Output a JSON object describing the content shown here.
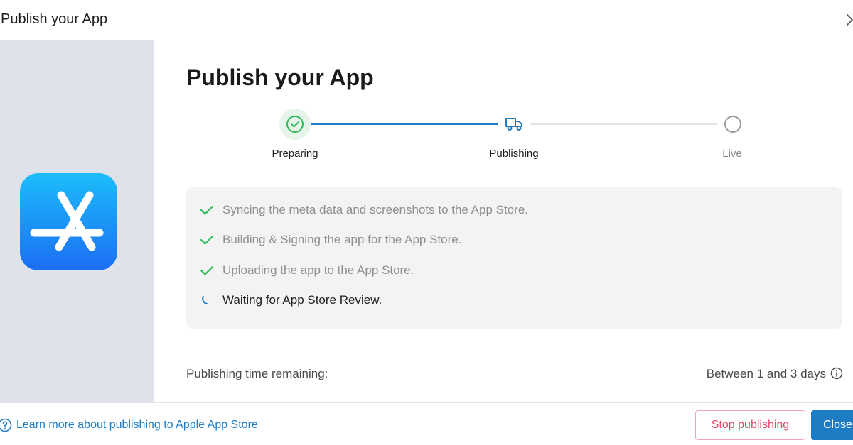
{
  "header": {
    "title": "Publish your App",
    "close_icon": "chevron-right-icon"
  },
  "sidebar": {
    "app_icon": "app-store-icon",
    "icon_gradient": [
      "#1dbdfb",
      "#1b6ef3"
    ]
  },
  "main": {
    "title": "Publish your App",
    "steps": [
      {
        "label": "Preparing",
        "state": "done",
        "icon": "check-circle-icon"
      },
      {
        "label": "Publishing",
        "state": "active",
        "icon": "truck-icon"
      },
      {
        "label": "Live",
        "state": "upcoming",
        "icon": "empty-circle-icon"
      }
    ],
    "tasks": [
      {
        "text": "Syncing the meta data and screenshots to the App Store.",
        "state": "done"
      },
      {
        "text": "Building & Signing the app for the App Store.",
        "state": "done"
      },
      {
        "text": "Uploading the app to the App Store.",
        "state": "done"
      },
      {
        "text": "Waiting for App Store Review.",
        "state": "in-progress"
      }
    ],
    "remaining_label": "Publishing time remaining:",
    "remaining_value": "Between 1 and 3 days"
  },
  "footer": {
    "learn_link": "Learn more about publishing to Apple App Store",
    "stop_button": "Stop publishing",
    "close_button": "Close"
  },
  "colors": {
    "accent": "#1e7cc4",
    "success": "#2ebd59",
    "danger": "#e5486a",
    "sidebar_bg": "#dee2ea"
  }
}
